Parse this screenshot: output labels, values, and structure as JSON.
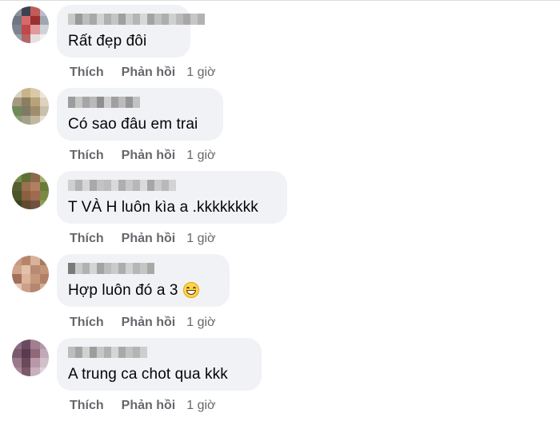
{
  "comments": [
    {
      "text": "Rất đẹp đôi",
      "like_label": "Thích",
      "reply_label": "Phản hồi",
      "time": "1 giờ",
      "avatar_colors": [
        "#8a8f9a",
        "#3c4250",
        "#c25a5a",
        "#b8bcc6",
        "#6f7686",
        "#d46a6a",
        "#9a3030",
        "#a0a6b2",
        "#7d8391",
        "#c04848",
        "#e09a9a",
        "#cfd2d8",
        "#9aa0ac",
        "#b56565",
        "#e8dede",
        "#f2f2f2"
      ],
      "name_blur_colors": [
        "#c8c8c8",
        "#9a9a9a",
        "#bdbdbd",
        "#a8a8a8",
        "#d2d2d2",
        "#b0b0b0",
        "#c4c4c4",
        "#9f9f9f",
        "#cccccc",
        "#b5b5b5",
        "#d8d8d8",
        "#a3a3a3",
        "#c0c0c0",
        "#aeaeae",
        "#d0d0d0",
        "#bababa",
        "#a8a8a8",
        "#c6c6c6",
        "#b2b2b2"
      ]
    },
    {
      "text": "Có sao đâu em trai",
      "like_label": "Thích",
      "reply_label": "Phản hồi",
      "time": "1 giờ",
      "avatar_colors": [
        "#d9d2c2",
        "#c9b38a",
        "#d8c9a9",
        "#ece6da",
        "#a59a80",
        "#8b7f62",
        "#b8a27a",
        "#dcd2bd",
        "#6f8a5a",
        "#7f7a66",
        "#a08c6a",
        "#c9c0aa",
        "#8aa070",
        "#a5a08a",
        "#bfb7a0",
        "#e6e0d2"
      ],
      "name_blur_colors": [
        "#9c9c9c",
        "#c6c6c6",
        "#a5a5a5",
        "#b9b9b9",
        "#8f8f8f",
        "#cfcfcf",
        "#a0a0a0",
        "#bbbbbb",
        "#969696",
        "#c2c2c2"
      ]
    },
    {
      "text": "T VÀ H luôn kìa a .kkkkkkkk",
      "like_label": "Thích",
      "reply_label": "Phản hồi",
      "time": "1 giờ",
      "avatar_colors": [
        "#7a8a4a",
        "#5f7035",
        "#8a6a4a",
        "#a6b06a",
        "#556030",
        "#9a7050",
        "#b08060",
        "#6a7a3a",
        "#4a5528",
        "#8a6040",
        "#a06a50",
        "#7a8a40",
        "#3a4520",
        "#604a30",
        "#705040",
        "#8aa050"
      ],
      "name_blur_colors": [
        "#cfcfcf",
        "#b3b3b3",
        "#d6d6d6",
        "#a9a9a9",
        "#c3c3c3",
        "#bdbdbd",
        "#d9d9d9",
        "#aeaeae",
        "#c8c8c8",
        "#b7b7b7",
        "#dadada",
        "#a6a6a6",
        "#cbcbcb",
        "#b9b9b9",
        "#d3d3d3"
      ]
    },
    {
      "text": "Hợp luôn đó a 3",
      "like_label": "Thích",
      "reply_label": "Phản hồi",
      "time": "1 giờ",
      "avatar_colors": [
        "#c99a80",
        "#b5856a",
        "#d8b29a",
        "#a87a60",
        "#d0a48a",
        "#e2c0aa",
        "#b88a70",
        "#c49478",
        "#a0705a",
        "#dcb49c",
        "#c8987c",
        "#b08068",
        "#e6c8b4",
        "#cca088",
        "#b48870",
        "#d4ac94"
      ],
      "name_blur_colors": [
        "#7a7a7a",
        "#c9c9c9",
        "#b1b1b1",
        "#d4d4d4",
        "#a2a2a2",
        "#bcbcbc",
        "#cacaca",
        "#adadad",
        "#d0d0d0",
        "#b6b6b6",
        "#c5c5c5",
        "#a8a8a8"
      ]
    },
    {
      "text": "A trung ca chot qua kkk",
      "like_label": "Thích",
      "reply_label": "Phản hồi",
      "time": "1 giờ",
      "avatar_colors": [
        "#8a6a80",
        "#6a4a60",
        "#a08090",
        "#b09aa8",
        "#7a5a70",
        "#5a3a50",
        "#906878",
        "#c0aab8",
        "#9a7a8a",
        "#6a4a5a",
        "#b898a8",
        "#d0c0c8",
        "#a88898",
        "#7a5a6a",
        "#c8b0bc",
        "#e0d4da"
      ],
      "name_blur_colors": [
        "#bdbdbd",
        "#a4a4a4",
        "#d1d1d1",
        "#9d9d9d",
        "#c7c7c7",
        "#b0b0b0",
        "#d5d5d5",
        "#a9a9a9",
        "#c2c2c2",
        "#b4b4b4",
        "#cecece"
      ]
    }
  ],
  "colors": {
    "bubble_bg": "#f0f2f5",
    "text": "#050505",
    "meta": "#65676b"
  }
}
